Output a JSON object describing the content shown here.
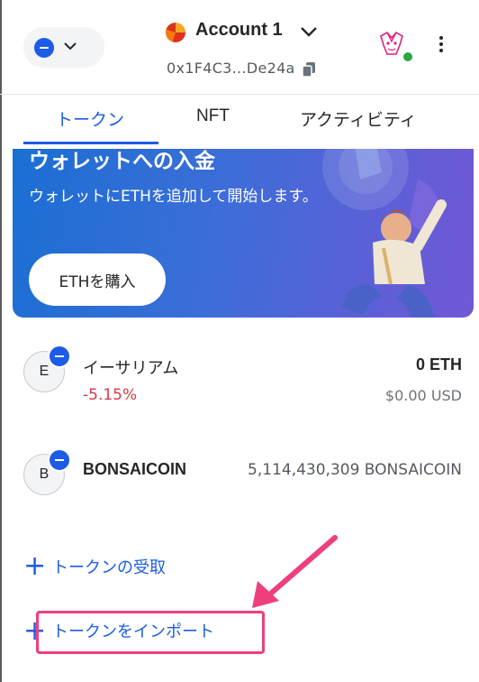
{
  "header": {
    "account_name": "Account 1",
    "address": "0x1F4C3...De24a",
    "icons": [
      "network-icon",
      "chevron-down-icon",
      "account-avatar",
      "copy-icon",
      "fox-icon",
      "status-dot",
      "kebab-menu-icon"
    ]
  },
  "tabs": [
    {
      "label": "トークン",
      "active": true
    },
    {
      "label": "NFT",
      "active": false
    },
    {
      "label": "アクティビティ",
      "active": false
    }
  ],
  "banner": {
    "title": "ウォレットへの入金",
    "description": "ウォレットにETHを追加して開始します。",
    "button_label": "ETHを購入"
  },
  "tokens": [
    {
      "avatar_letter": "E",
      "name": "イーサリアム",
      "change": "-5.15%",
      "balance": "0 ETH",
      "fiat": "$0.00 USD"
    },
    {
      "avatar_letter": "B",
      "name": "BONSAICOIN",
      "balance": "5,114,430,309 BONSAICOIN"
    }
  ],
  "actions": {
    "receive_label": "トークンの受取",
    "import_label": "トークンをインポート"
  },
  "colors": {
    "accent": "#1c5ce6",
    "negative": "#d73847",
    "highlight": "#ef3e7e",
    "banner_start": "#1a6fd3",
    "banner_end": "#7257d6"
  }
}
